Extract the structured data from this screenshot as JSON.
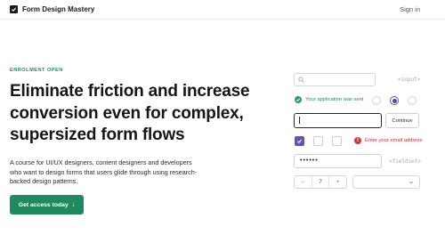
{
  "header": {
    "brand": "Form Design Mastery",
    "signin_label": "Sign in"
  },
  "hero": {
    "eyebrow": "ENROLMENT OPEN",
    "headline_lines": [
      "Eliminate friction and increase",
      "conversion even for complex,",
      "supersized form flows"
    ],
    "subcopy_lines": [
      "A course for UI/UX designers, content designers and developers",
      "who want to design forms that users glide through using research-",
      "backed design patterns."
    ],
    "cta_label": "Get access today",
    "cta_icon": "arrow-down-icon"
  },
  "components": {
    "input_tag": "<input>",
    "success_message": "Your application was sent",
    "continue_label": "Continue",
    "error_message": "Enter your email address",
    "error_icon_glyph": "!",
    "password_value": "••••••",
    "fieldset_tag": "<fieldset>",
    "stepper": {
      "minus": "−",
      "value": "7",
      "plus": "+"
    }
  },
  "colors": {
    "accent_green": "#1f8a5d",
    "purple": "#6b4fb8",
    "error_red": "#d33a3a"
  }
}
